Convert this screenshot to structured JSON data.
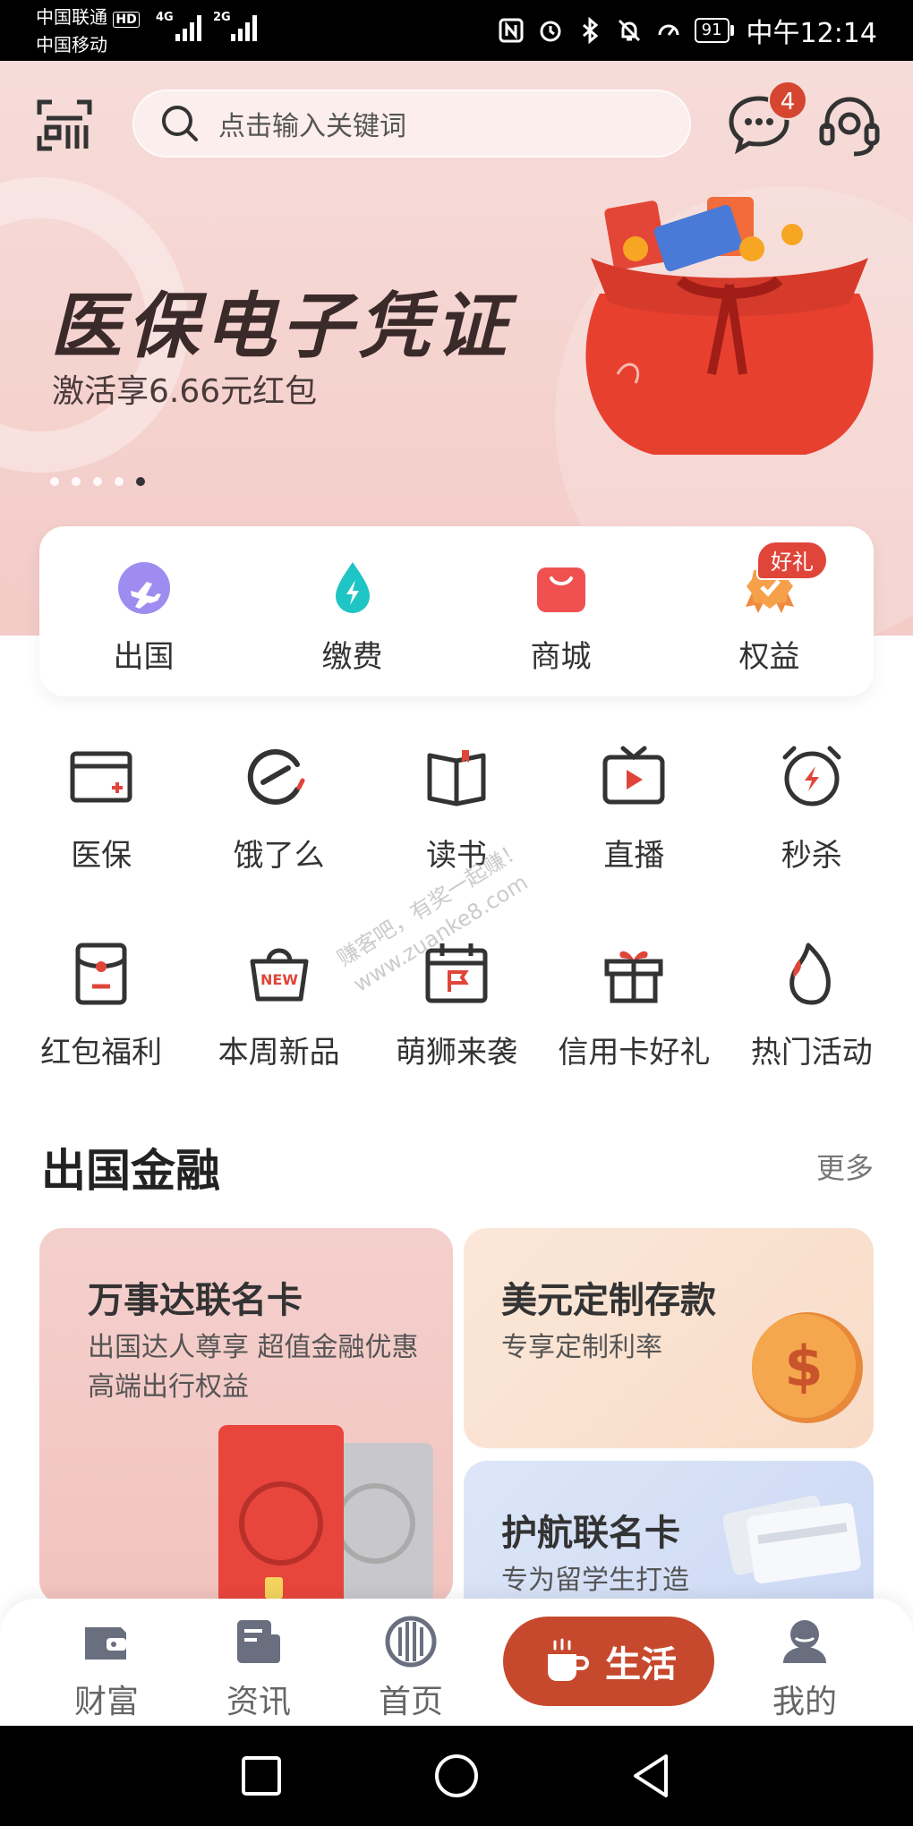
{
  "status_bar": {
    "carrier1": "中国联通",
    "carrier1_tag": "HD",
    "carrier2": "中国移动",
    "net1": "4G",
    "net2": "2G",
    "battery": "91",
    "time": "中午12:14"
  },
  "header": {
    "search_placeholder": "点击输入关键词",
    "message_count": "4"
  },
  "banner": {
    "title": "医保电子凭证",
    "subtitle": "激活享6.66元红包",
    "dots_total": 5,
    "dots_active_index": 4
  },
  "quick_entries": [
    {
      "label": "出国",
      "icon": "plane-icon"
    },
    {
      "label": "缴费",
      "icon": "water-drop-bolt-icon"
    },
    {
      "label": "商城",
      "icon": "shopping-bag-icon"
    },
    {
      "label": "权益",
      "icon": "medal-icon"
    }
  ],
  "gift_badge": "好礼",
  "grid_row1": [
    {
      "label": "医保",
      "icon": "medical-card-icon"
    },
    {
      "label": "饿了么",
      "icon": "eleme-icon"
    },
    {
      "label": "读书",
      "icon": "book-icon"
    },
    {
      "label": "直播",
      "icon": "tv-play-icon"
    },
    {
      "label": "秒杀",
      "icon": "alarm-bolt-icon"
    }
  ],
  "grid_row2": [
    {
      "label": "红包福利",
      "icon": "red-envelope-icon"
    },
    {
      "label": "本周新品",
      "icon": "new-basket-icon"
    },
    {
      "label": "萌狮来袭",
      "icon": "calendar-flag-icon"
    },
    {
      "label": "信用卡好礼",
      "icon": "gift-box-icon"
    },
    {
      "label": "热门活动",
      "icon": "flame-icon"
    }
  ],
  "watermark": {
    "line1": "赚客吧，有奖一起赚！",
    "line2": "www.zuanke8.com"
  },
  "section": {
    "title": "出国金融",
    "more": "更多"
  },
  "cards": {
    "mastercard": {
      "title": "万事达联名卡",
      "desc": "出国达人尊享  超值金融优惠  高端出行权益"
    },
    "usd_deposit": {
      "title": "美元定制存款",
      "desc": "专享定制利率"
    },
    "voyage_card": {
      "title": "护航联名卡",
      "desc": "专为留学生打造"
    }
  },
  "bottom_nav": [
    {
      "label": "财富",
      "icon": "wallet-icon"
    },
    {
      "label": "资讯",
      "icon": "news-icon"
    },
    {
      "label": "首页",
      "icon": "citic-logo-icon"
    },
    {
      "label": "生活",
      "icon": "coffee-cup-icon",
      "active": true
    },
    {
      "label": "我的",
      "icon": "user-icon"
    }
  ],
  "colors": {
    "brand_red": "#c7492d",
    "badge_red": "#d5452f",
    "hero_pink": "#f6dcd9",
    "text_dark": "#333333"
  }
}
